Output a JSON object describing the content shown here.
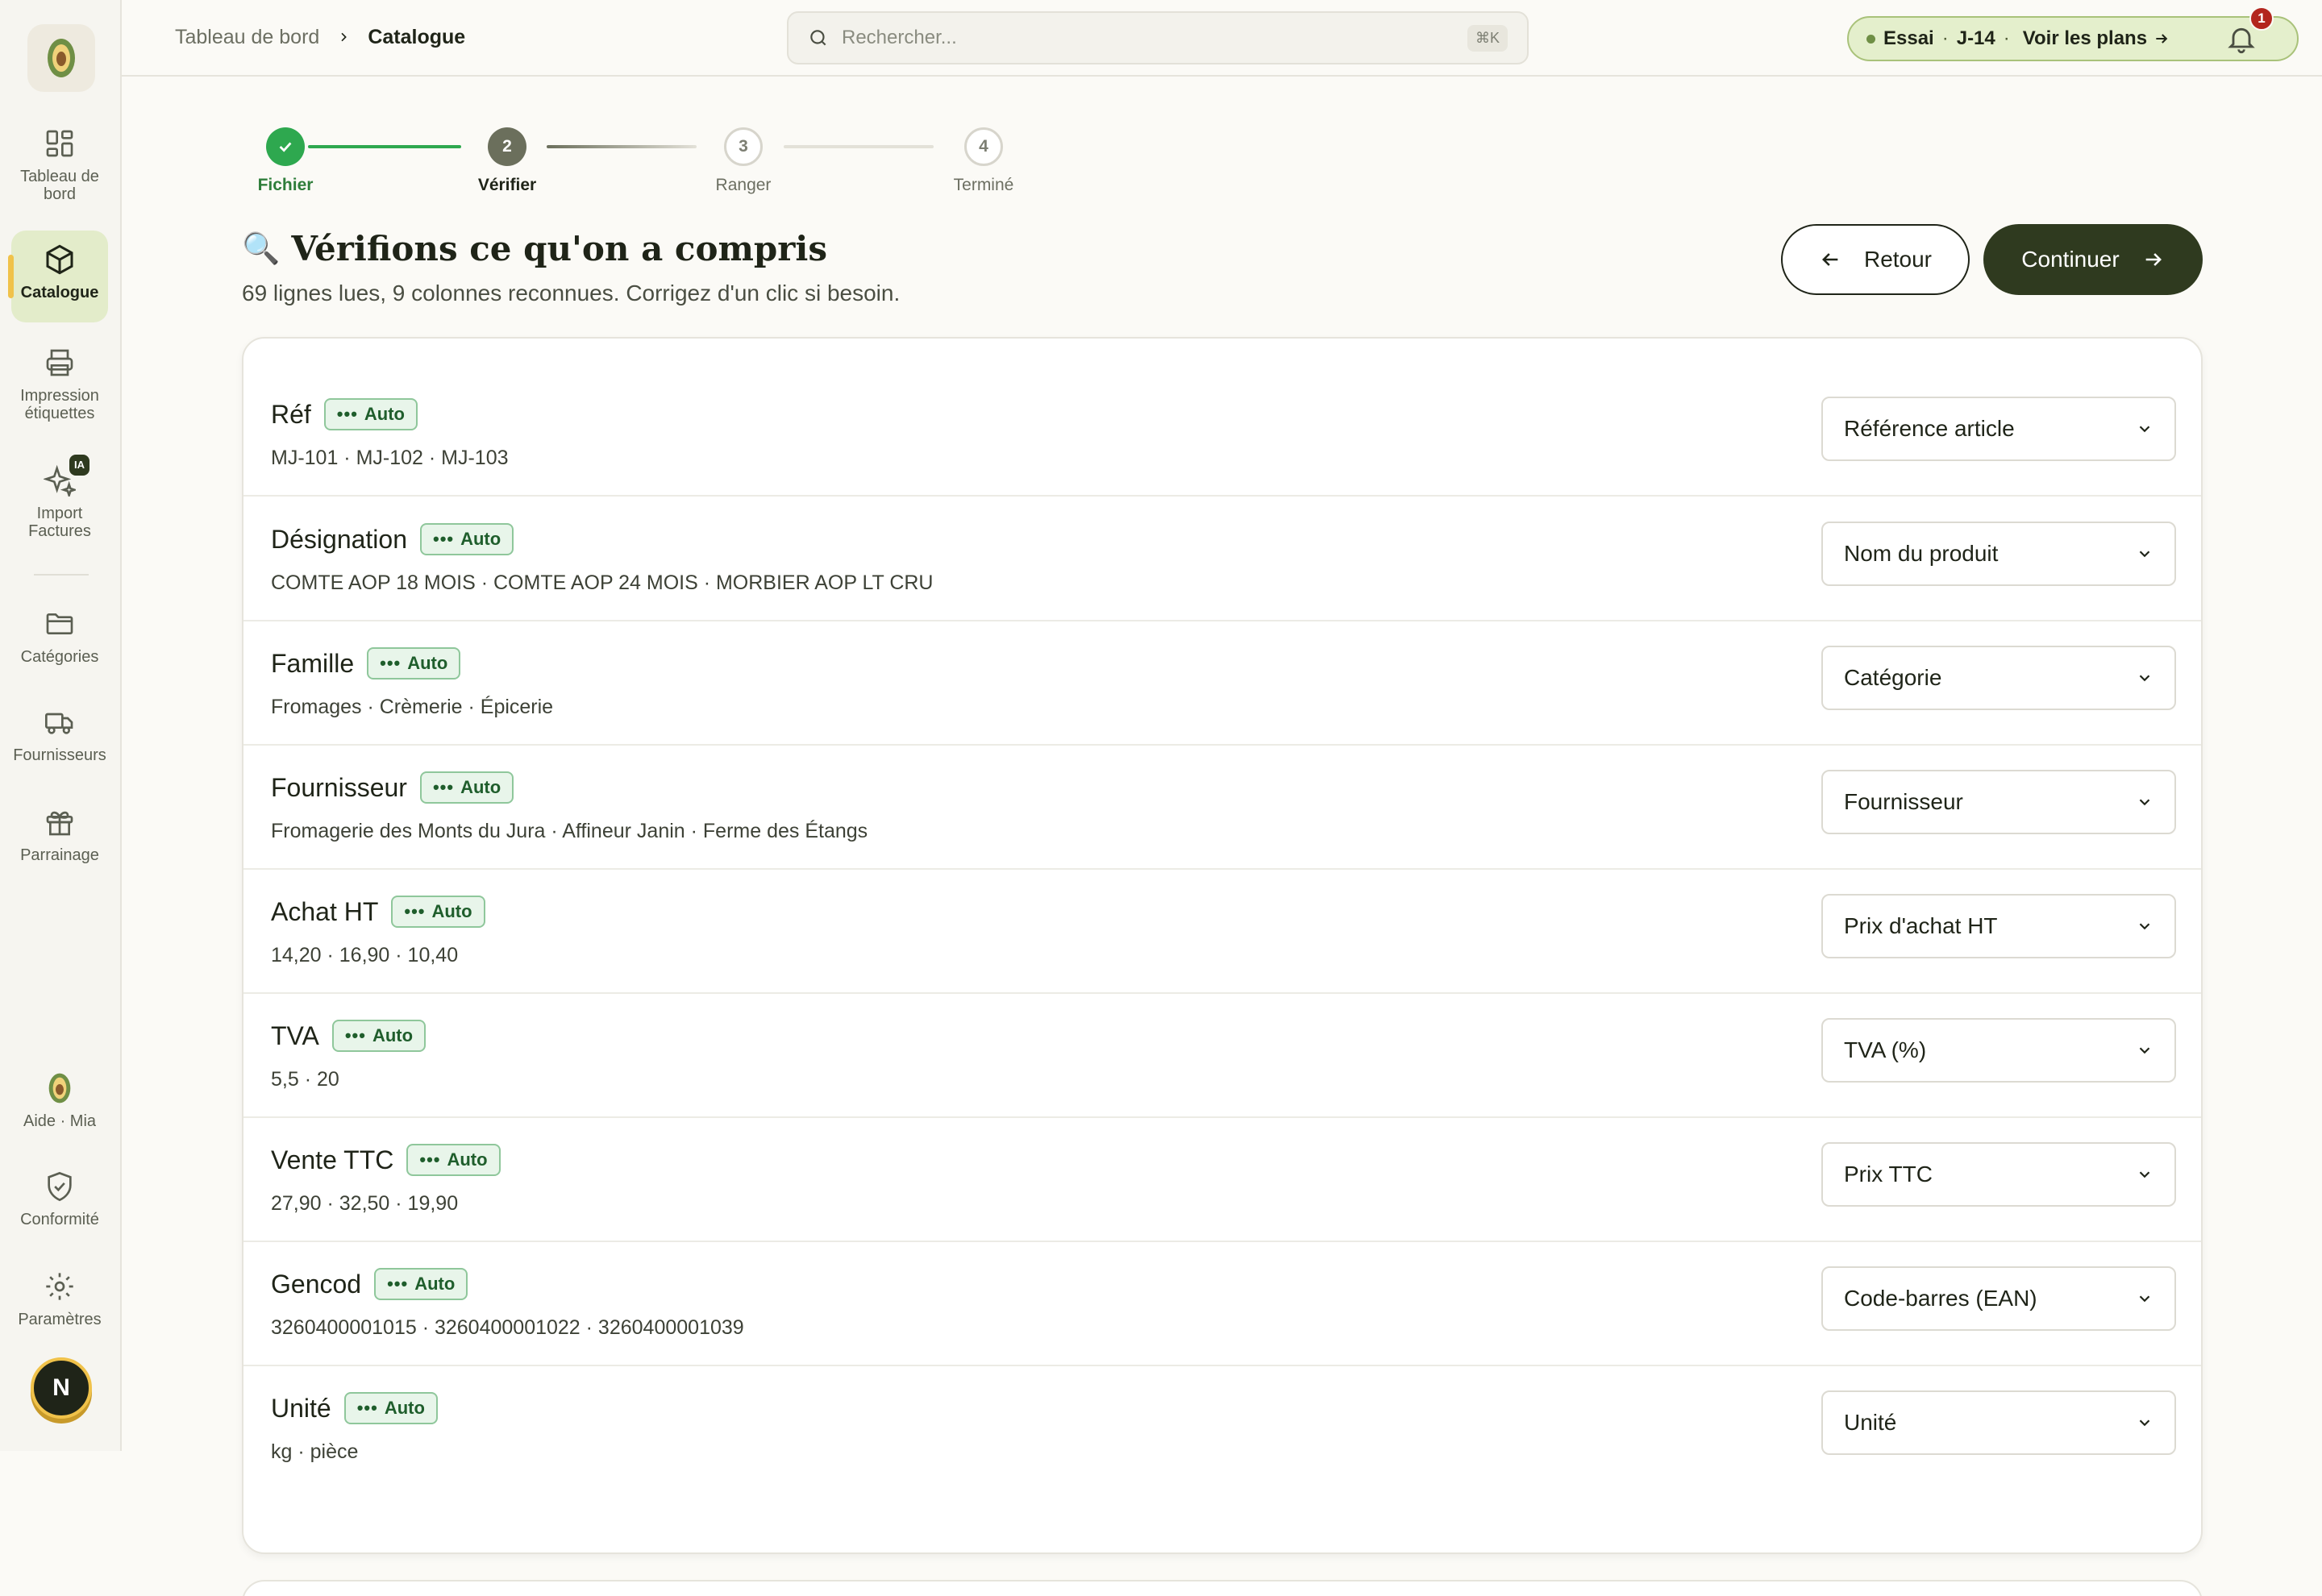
{
  "sidebar": {
    "logo_icon": "avocado-logo-icon",
    "items": [
      {
        "label": "Tableau de bord",
        "icon": "grid-icon"
      },
      {
        "label": "Catalogue",
        "icon": "box-icon",
        "active": true
      },
      {
        "label": "Impression étiquettes",
        "icon": "printer-icon"
      },
      {
        "label": "Import Factures",
        "icon": "sparkle-icon",
        "badge": "IA"
      },
      {
        "label": "Catégories",
        "icon": "folder-icon"
      },
      {
        "label": "Fournisseurs",
        "icon": "truck-icon"
      },
      {
        "label": "Parrainage",
        "icon": "gift-icon"
      },
      {
        "label": "Aide · Mia",
        "icon": "avocado-icon"
      },
      {
        "label": "Conformité",
        "icon": "shield-check-icon"
      },
      {
        "label": "Paramètres",
        "icon": "gear-icon"
      }
    ],
    "avatar_initial": "N"
  },
  "header": {
    "breadcrumb": [
      "Tableau de bord",
      "Catalogue"
    ],
    "search_placeholder": "Rechercher...",
    "search_shortcut": "⌘K",
    "trial": {
      "label": "Essai",
      "days": "J-14",
      "link": "Voir les plans"
    },
    "notifications_count": "1"
  },
  "stepper": {
    "steps": [
      {
        "number": "1",
        "label": "Fichier",
        "state": "done"
      },
      {
        "number": "2",
        "label": "Vérifier",
        "state": "current"
      },
      {
        "number": "3",
        "label": "Ranger",
        "state": "todo"
      },
      {
        "number": "4",
        "label": "Terminé",
        "state": "todo"
      }
    ]
  },
  "page": {
    "emoji": "🔍",
    "title": "Vérifions ce qu'on a compris",
    "subtitle": "69 lignes lues, 9 colonnes reconnues. Corrigez d'un clic si besoin.",
    "back_label": "Retour",
    "continue_label": "Continuer"
  },
  "mapping": {
    "badge_label": "Auto",
    "rows": [
      {
        "column": "Réf",
        "samples": "MJ-101 · MJ-102 · MJ-103",
        "target": "Référence article"
      },
      {
        "column": "Désignation",
        "samples": "COMTE AOP 18 MOIS · COMTE AOP 24 MOIS · MORBIER AOP LT CRU",
        "target": "Nom du produit"
      },
      {
        "column": "Famille",
        "samples": "Fromages · Crèmerie · Épicerie",
        "target": "Catégorie"
      },
      {
        "column": "Fournisseur",
        "samples": "Fromagerie des Monts du Jura · Affineur Janin · Ferme des Étangs",
        "target": "Fournisseur"
      },
      {
        "column": "Achat HT",
        "samples": "14,20 · 16,90 · 10,40",
        "target": "Prix d'achat HT"
      },
      {
        "column": "TVA",
        "samples": "5,5 · 20",
        "target": "TVA (%)"
      },
      {
        "column": "Vente TTC",
        "samples": "27,90 · 32,50 · 19,90",
        "target": "Prix TTC"
      },
      {
        "column": "Gencod",
        "samples": "3260400001015 · 3260400001022 · 3260400001039",
        "target": "Code-barres (EAN)"
      },
      {
        "column": "Unité",
        "samples": "kg · pièce",
        "target": "Unité"
      }
    ]
  },
  "colors": {
    "accent_dark": "#2f3a1f",
    "success": "#2ea84f",
    "active_nav": "#e3ecca",
    "badge_bg": "#e8f5ea",
    "alert": "#b3261e"
  }
}
